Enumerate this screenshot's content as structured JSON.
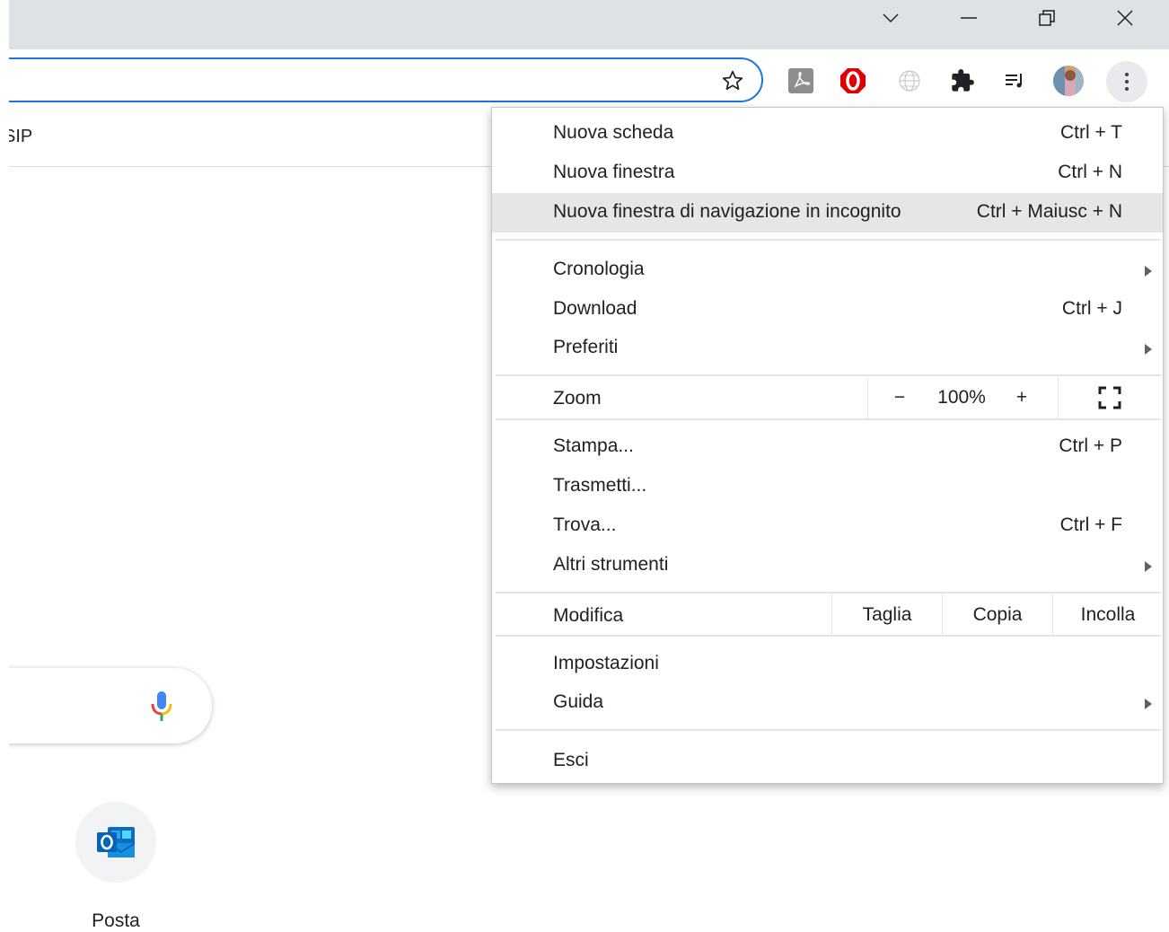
{
  "window": {
    "controls": [
      "chevron-down-icon",
      "minimize-icon",
      "restore-icon",
      "close-icon"
    ]
  },
  "bookmarks_bar": {
    "item_label": "SIP"
  },
  "extensions": [
    "pdf-extension-icon",
    "opera-extension-icon",
    "globe-extension-icon",
    "puzzle-extensions-icon",
    "media-queue-icon",
    "profile-avatar"
  ],
  "menu": {
    "group1": [
      {
        "label": "Nuova scheda",
        "shortcut": "Ctrl + T"
      },
      {
        "label": "Nuova finestra",
        "shortcut": "Ctrl + N"
      },
      {
        "label": "Nuova finestra di navigazione in incognito",
        "shortcut": "Ctrl + Maiusc + N"
      }
    ],
    "group2": [
      {
        "label": "Cronologia"
      },
      {
        "label": "Download",
        "shortcut": "Ctrl + J"
      },
      {
        "label": "Preferiti"
      }
    ],
    "zoom": {
      "label": "Zoom",
      "minus": "−",
      "value": "100%",
      "plus": "+"
    },
    "group3": [
      {
        "label": "Stampa...",
        "shortcut": "Ctrl + P"
      },
      {
        "label": "Trasmetti..."
      },
      {
        "label": "Trova...",
        "shortcut": "Ctrl + F"
      },
      {
        "label": "Altri strumenti"
      }
    ],
    "edit": {
      "label": "Modifica",
      "cut": "Taglia",
      "copy": "Copia",
      "paste": "Incolla"
    },
    "group4": [
      {
        "label": "Impostazioni"
      },
      {
        "label": "Guida"
      }
    ],
    "exit": {
      "label": "Esci"
    }
  },
  "shortcuts": [
    {
      "label": "Posta"
    }
  ],
  "colors": {
    "accent": "#1a73e8",
    "highlight": "#e6e6e6",
    "titlebar": "#dee1e6"
  }
}
